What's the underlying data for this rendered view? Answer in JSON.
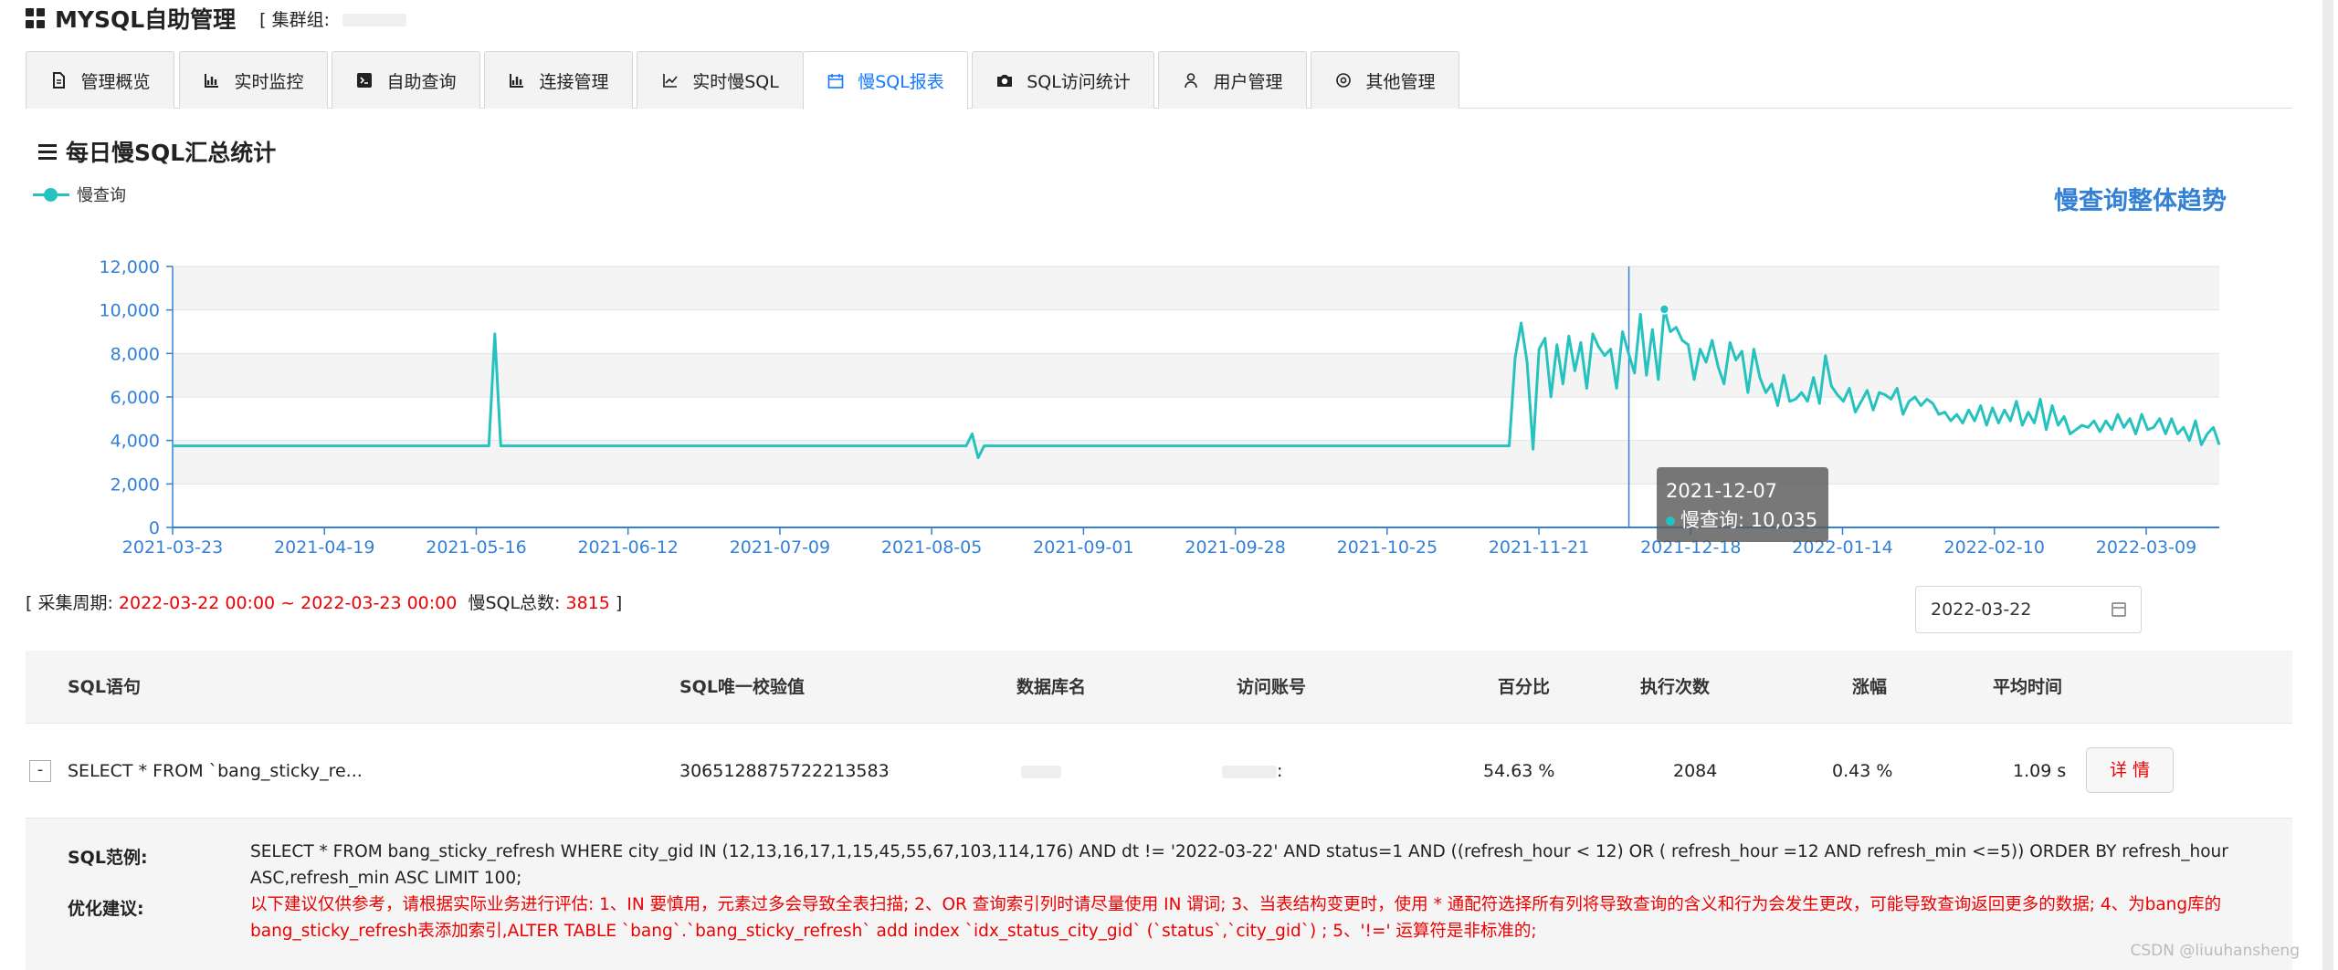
{
  "header": {
    "title": "MYSQL自助管理",
    "cluster_label": "[ 集群组:"
  },
  "tabs": [
    {
      "label": "管理概览",
      "icon": "file-icon"
    },
    {
      "label": "实时监控",
      "icon": "bar-chart-icon"
    },
    {
      "label": "自助查询",
      "icon": "terminal-icon"
    },
    {
      "label": "连接管理",
      "icon": "bar-chart-icon"
    },
    {
      "label": "实时慢SQL",
      "icon": "line-chart-icon"
    },
    {
      "label": "慢SQL报表",
      "icon": "calendar-icon",
      "active": true
    },
    {
      "label": "SQL访问统计",
      "icon": "camera-icon"
    },
    {
      "label": "用户管理",
      "icon": "user-icon"
    },
    {
      "label": "其他管理",
      "icon": "settings-icon"
    }
  ],
  "section": {
    "title": "每日慢SQL汇总统计"
  },
  "chart_title": "慢查询整体趋势",
  "chart_data": {
    "type": "line",
    "series": [
      {
        "name": "慢查询",
        "color": "#25c2c0",
        "values": [
          3750,
          3750,
          3750,
          3750,
          3750,
          3750,
          3750,
          3750,
          3750,
          3750,
          3750,
          3750,
          3750,
          3750,
          3750,
          3750,
          3750,
          3750,
          3750,
          3750,
          3750,
          3750,
          3750,
          3750,
          3750,
          3750,
          3750,
          3750,
          3750,
          3750,
          3750,
          3750,
          3750,
          3750,
          3750,
          3750,
          3750,
          3750,
          3750,
          3750,
          3750,
          3750,
          3750,
          3750,
          3750,
          3750,
          3750,
          3750,
          3750,
          3750,
          3750,
          3750,
          3750,
          3750,
          8900,
          3750,
          3750,
          3750,
          3750,
          3750,
          3750,
          3750,
          3750,
          3750,
          3750,
          3750,
          3750,
          3750,
          3750,
          3750,
          3750,
          3750,
          3750,
          3750,
          3750,
          3750,
          3750,
          3750,
          3750,
          3750,
          3750,
          3750,
          3750,
          3750,
          3750,
          3750,
          3750,
          3750,
          3750,
          3750,
          3750,
          3750,
          3750,
          3750,
          3750,
          3750,
          3750,
          3750,
          3750,
          3750,
          3750,
          3750,
          3750,
          3750,
          3750,
          3750,
          3750,
          3750,
          3750,
          3750,
          3750,
          3750,
          3750,
          3750,
          3750,
          3750,
          3750,
          3750,
          3750,
          3750,
          3750,
          3750,
          3750,
          3750,
          3750,
          3750,
          3750,
          3750,
          3750,
          3750,
          3750,
          3750,
          3750,
          3750,
          4300,
          3200,
          3750,
          3750,
          3750,
          3750,
          3750,
          3750,
          3750,
          3750,
          3750,
          3750,
          3750,
          3750,
          3750,
          3750,
          3750,
          3750,
          3750,
          3750,
          3750,
          3750,
          3750,
          3750,
          3750,
          3750,
          3750,
          3750,
          3750,
          3750,
          3750,
          3750,
          3750,
          3750,
          3750,
          3750,
          3750,
          3750,
          3750,
          3750,
          3750,
          3750,
          3750,
          3750,
          3750,
          3750,
          3750,
          3750,
          3750,
          3750,
          3750,
          3750,
          3750,
          3750,
          3750,
          3750,
          3750,
          3750,
          3750,
          3750,
          3750,
          3750,
          3750,
          3750,
          3750,
          3750,
          3750,
          3750,
          3750,
          3750,
          3750,
          3750,
          3750,
          3750,
          3750,
          3750,
          3750,
          3750,
          3750,
          3750,
          3750,
          3750,
          3750,
          3750,
          3750,
          3750,
          3750,
          3750,
          3750,
          3750,
          3750,
          7800,
          9400,
          7600,
          3600,
          8200,
          8700,
          6000,
          8400,
          6600,
          8800,
          7200,
          8500,
          6400,
          8900,
          8300,
          7900,
          8200,
          6400,
          9000,
          8000,
          7100,
          9800,
          7000,
          9100,
          6800,
          10035,
          9000,
          9200,
          8600,
          8400,
          6800,
          8200,
          7600,
          8600,
          7400,
          6600,
          8500,
          7700,
          8100,
          6200,
          8200,
          6900,
          6200,
          6600,
          5600,
          7000,
          5800,
          5900,
          6200,
          5800,
          6900,
          5700,
          7900,
          6500,
          6100,
          5800,
          6400,
          5300,
          5800,
          6300,
          5400,
          6200,
          6100,
          5900,
          6400,
          5200,
          5800,
          6000,
          5600,
          5900,
          5700,
          5200,
          5300,
          4900,
          5200,
          4800,
          5400,
          4900,
          5600,
          4700,
          5500,
          4800,
          5400,
          4900,
          5800,
          4700,
          5300,
          4800,
          5900,
          4500,
          5600,
          4700,
          5100,
          4300,
          4500,
          4700,
          4600,
          4900,
          4400,
          4900,
          4500,
          5200,
          4600,
          5000,
          4300,
          5200,
          4500,
          4600,
          5000,
          4300,
          5000,
          4300,
          4600,
          4000,
          4900,
          3800,
          4300,
          4600,
          3800
        ]
      }
    ],
    "xticks": [
      "2021-03-23",
      "2021-04-19",
      "2021-05-16",
      "2021-06-12",
      "2021-07-09",
      "2021-08-05",
      "2021-09-01",
      "2021-09-28",
      "2021-10-25",
      "2021-11-21",
      "2021-12-18",
      "2022-01-14",
      "2022-02-10",
      "2022-03-09"
    ],
    "yticks": [
      "0",
      "2,000",
      "4,000",
      "6,000",
      "8,000",
      "10,000",
      "12,000"
    ],
    "ylim": [
      0,
      12000
    ],
    "x_start": "2021-03-23",
    "x_end": "2022-03-22",
    "grid": true,
    "legend_position": "top-left",
    "tooltip": {
      "date": "2021-12-07",
      "label": "慢查询: 10,035"
    }
  },
  "period": {
    "label_prefix": "[ 采集周期:",
    "range": "2022-03-22 00:00 ~ 2022-03-23 00:00",
    "total_label": "慢SQL总数:",
    "total": "3815",
    "suffix": "]"
  },
  "date_picker": {
    "value": "2022-03-22"
  },
  "table": {
    "headers": [
      "SQL语句",
      "SQL唯一校验值",
      "数据库名",
      "访问账号",
      "百分比",
      "执行次数",
      "涨幅",
      "平均时间"
    ],
    "row": {
      "toggle": "-",
      "sql": "SELECT * FROM `bang_sticky_re...",
      "checksum": "3065128875722213583",
      "account_suffix": ":",
      "percent": "54.63 %",
      "exec_count": "2084",
      "growth": "0.43 %",
      "avg_time": "1.09 s",
      "detail_label": "详 情"
    }
  },
  "expand": {
    "example_label": "SQL范例:",
    "example_text": "SELECT * FROM bang_sticky_refresh WHERE city_gid IN (12,13,16,17,1,15,45,55,67,103,114,176) AND dt != '2022-03-22' AND status=1 AND ((refresh_hour < 12) OR ( refresh_hour =12 AND refresh_min <=5)) ORDER BY refresh_hour ASC,refresh_min ASC LIMIT 100;",
    "advice_label": "优化建议:",
    "advice_text": "以下建议仅供参考，请根据实际业务进行评估: 1、IN 要慎用，元素过多会导致全表扫描; 2、OR 查询索引列时请尽量使用 IN 谓词; 3、当表结构变更时，使用 * 通配符选择所有列将导致查询的含义和行为会发生更改，可能导致查询返回更多的数据; 4、为bang库的bang_sticky_refresh表添加索引,ALTER TABLE `bang`.`bang_sticky_refresh` add index `idx_status_city_gid` (`status`,`city_gid`) ; 5、'!=' 运算符是非标准的;"
  },
  "watermark": "CSDN @liuuhansheng"
}
